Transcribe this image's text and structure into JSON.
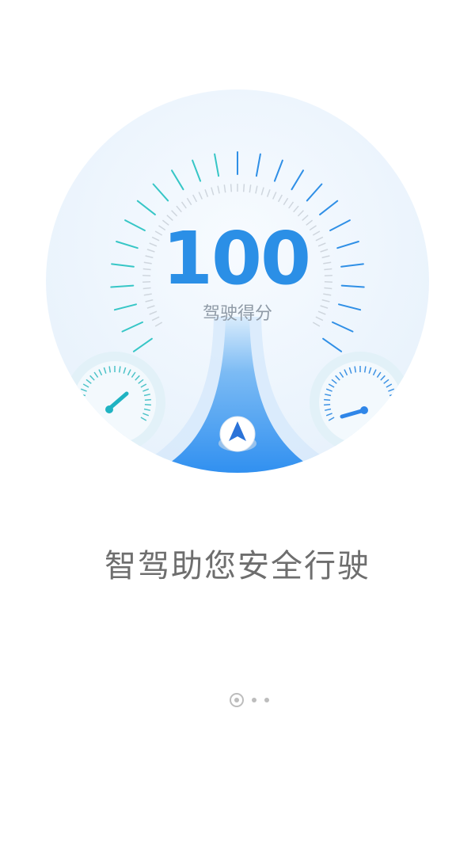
{
  "score": {
    "value": "100",
    "label": "驾驶得分"
  },
  "slogan": "智驾助您安全行驶",
  "pager": {
    "total_pages": 3,
    "current_page": 1
  },
  "icons": {
    "navigation": "navigation-arrow-icon",
    "left_gauge": "left-mini-gauge-icon",
    "right_gauge": "right-mini-gauge-icon"
  },
  "colors": {
    "primary_blue": "#2f8ff0",
    "score_blue": "#2b8fe6",
    "tick_teal": "#33c4c8",
    "circle_bg": "#eef5fd",
    "text_gray": "#6e6e6e"
  }
}
